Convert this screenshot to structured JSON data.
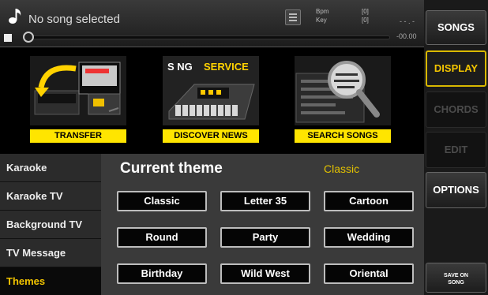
{
  "header": {
    "song_title": "No song selected",
    "meta_labels": [
      "Bpm",
      "Key"
    ],
    "meta_values": [
      "[0]",
      "[0]"
    ],
    "time_top": "- - . -",
    "time_bottom": "-00.00",
    "progress": 0
  },
  "banners": [
    {
      "caption": "TRANSFER",
      "icon": "transfer-devices-image"
    },
    {
      "caption": "DISCOVER NEWS",
      "logo_text_a": "S NG",
      "logo_text_b": "SERVICE",
      "icon": "songservice-keyboard-image"
    },
    {
      "caption": "SEARCH SONGS",
      "icon": "magnifier-search-image"
    }
  ],
  "left_menu": {
    "items": [
      "Karaoke",
      "Karaoke TV",
      "Background TV",
      "TV Message",
      "Themes"
    ],
    "selected": "Themes"
  },
  "theme_panel": {
    "label": "Current theme",
    "value": "Classic",
    "themes": [
      "Classic",
      "Letter 35",
      "Cartoon",
      "Round",
      "Party",
      "Wedding",
      "Birthday",
      "Wild West",
      "Oriental"
    ]
  },
  "right_menu": {
    "songs": "SONGS",
    "display": "DISPLAY",
    "chords": "CHORDS",
    "edit": "EDIT",
    "options": "OPTIONS",
    "save_on_song": [
      "SAVE ON",
      "SONG"
    ]
  },
  "colors": {
    "accent": "#f2c400",
    "banner_caption_bg": "#ffe500",
    "panel_bg": "#3a3a3a"
  }
}
